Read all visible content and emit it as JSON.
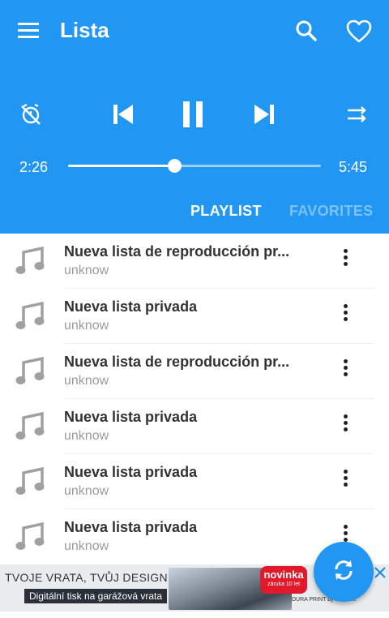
{
  "header": {
    "title": "Lista",
    "icons": {
      "menu": "menu-icon",
      "search": "search-icon",
      "favorite": "heart-icon"
    }
  },
  "player": {
    "controls": [
      "timer-off-icon",
      "skip-previous-icon",
      "pause-icon",
      "skip-next-icon",
      "shuffle-icon"
    ],
    "current_time": "2:26",
    "duration": "5:45",
    "progress": 0.42
  },
  "tabs": [
    {
      "label": "PLAYLIST",
      "active": true
    },
    {
      "label": "FAVORITES",
      "active": false
    }
  ],
  "playlists": [
    {
      "name": "Nueva lista de reproducción pr...",
      "artist": "unknow"
    },
    {
      "name": "Nueva lista privada",
      "artist": "unknow"
    },
    {
      "name": "Nueva lista de reproducción pr...",
      "artist": "unknow"
    },
    {
      "name": "Nueva lista privada",
      "artist": "unknow"
    },
    {
      "name": "Nueva lista privada",
      "artist": "unknow"
    },
    {
      "name": "Nueva lista privada",
      "artist": "unknow"
    }
  ],
  "ad": {
    "headline": "TVOJE VRATA, TVŮJ DESIGN...",
    "subline": "Digitální tisk na garážová vrata",
    "badge_title": "novinka",
    "badge_sub": "záruka 10 let",
    "brand": "DURA PRINT by KRUŽÍK"
  },
  "fab": {
    "icon": "sync-icon"
  },
  "colors": {
    "primary": "#2196f3",
    "tab_inactive": "#7cc2f7",
    "ad_badge": "#e0192b"
  }
}
